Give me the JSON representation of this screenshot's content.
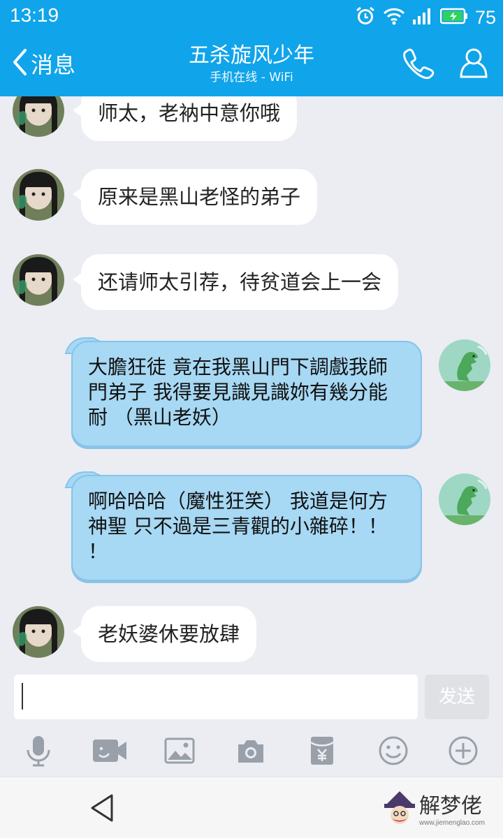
{
  "status_bar": {
    "time": "13:19",
    "battery": "75",
    "icons": [
      "alarm-icon",
      "wifi-icon",
      "signal-icon",
      "battery-icon"
    ]
  },
  "header": {
    "back_label": "消息",
    "title": "五杀旋风少年",
    "subtitle": "手机在线 - WiFi",
    "icons": [
      "back-chevron-icon",
      "phone-icon",
      "profile-icon"
    ]
  },
  "messages": [
    {
      "side": "left",
      "text": "师太，老衲中意你哦"
    },
    {
      "side": "left",
      "text": "原来是黑山老怪的弟子"
    },
    {
      "side": "left",
      "text": "还请师太引荐，待贫道会上一会"
    },
    {
      "side": "right",
      "lines": [
        "大膽狂徒  竟在我黑山門下調戲我師",
        "門弟子  我得要見識見識妳有幾分能",
        "耐  （黑山老妖）"
      ]
    },
    {
      "side": "right",
      "lines": [
        "啊哈哈哈（魔性狂笑）  我道是何方",
        "神聖  只不過是三青觀的小雜碎！！",
        "！"
      ]
    },
    {
      "side": "left",
      "text": "老妖婆休要放肆"
    }
  ],
  "input": {
    "value": "",
    "send_label": "发送"
  },
  "toolbar": {
    "icons": [
      "microphone-icon",
      "video-call-icon",
      "image-icon",
      "camera-icon",
      "red-packet-icon",
      "emoji-icon",
      "plus-icon"
    ]
  },
  "watermark": {
    "text": "解梦佬",
    "url": "www.jiemenglao.com"
  },
  "colors": {
    "accent": "#10a4ea",
    "bubble_right": "#a7d8f4",
    "background": "#ebedf2"
  }
}
